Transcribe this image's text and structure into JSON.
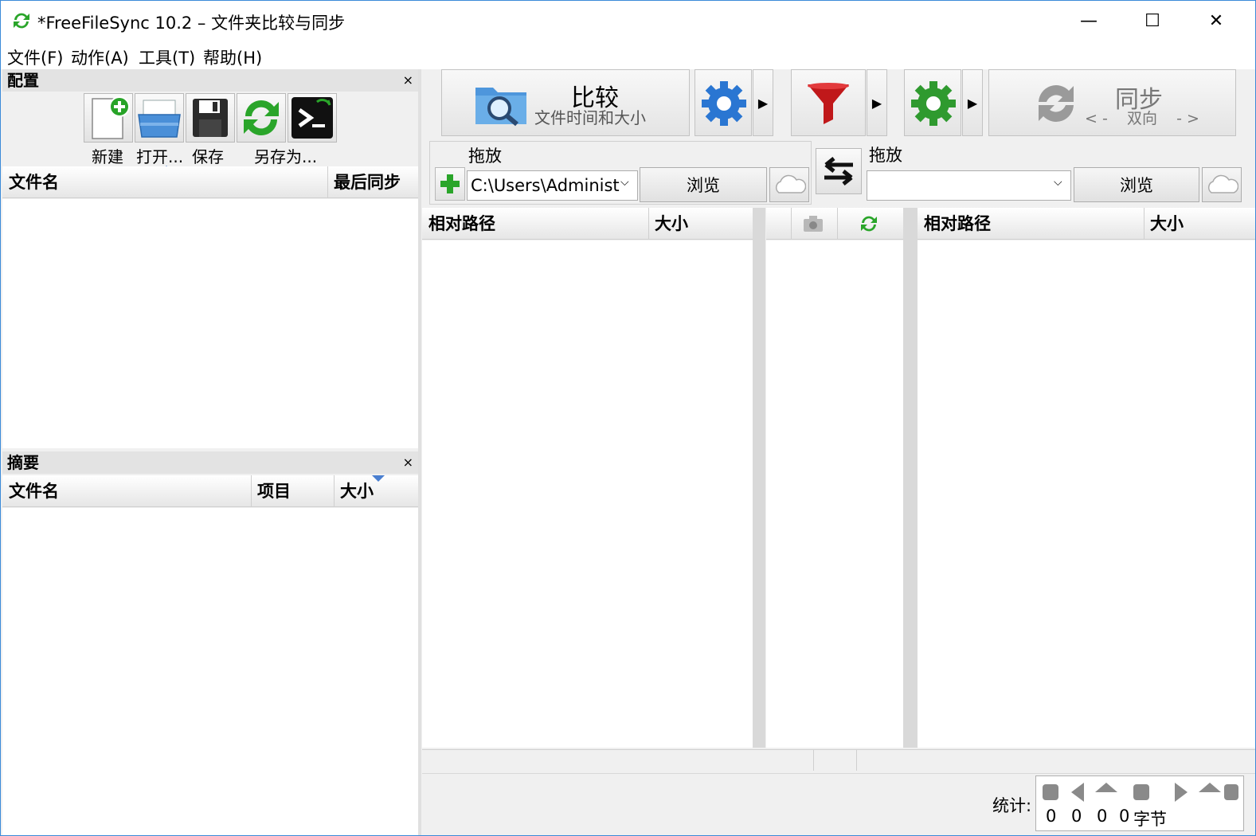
{
  "window": {
    "title": "*FreeFileSync 10.2 – 文件夹比较与同步",
    "minimize": "—",
    "maximize": "☐",
    "close": "✕"
  },
  "menu": [
    "文件(F)",
    "动作(A)",
    "工具(T)",
    "帮助(H)"
  ],
  "config_panel": {
    "title": "配置",
    "close": "×",
    "buttons": [
      "新建",
      "打开...",
      "保存",
      "另存为..."
    ],
    "columns": [
      "文件名",
      "最后同步"
    ]
  },
  "summary_panel": {
    "title": "摘要",
    "close": "×",
    "columns": [
      "文件名",
      "项目",
      "大小"
    ]
  },
  "toolbar": {
    "compare_title": "比较",
    "compare_subtitle": "文件时间和大小",
    "sync_title": "同步",
    "sync_subtitle": "< -    双向    - >"
  },
  "left_folder": {
    "drop_label": "拖放",
    "path": "C:\\Users\\Administ",
    "browse": "浏览"
  },
  "right_folder": {
    "drop_label": "拖放",
    "path": "",
    "browse": "浏览"
  },
  "grid": {
    "left_columns": [
      "相对路径",
      "大小"
    ],
    "right_columns": [
      "相对路径",
      "大小"
    ]
  },
  "status": {
    "stats_label": "统计:",
    "counts": [
      "0",
      "0",
      "0",
      "0"
    ],
    "bytes_label": "字节"
  },
  "colors": {
    "accent": "#3b8ad9",
    "sync_green": "#2aa52a",
    "filter_red": "#c0181a",
    "gear_blue": "#2a76d2",
    "gear_green": "#2f9a2f"
  }
}
